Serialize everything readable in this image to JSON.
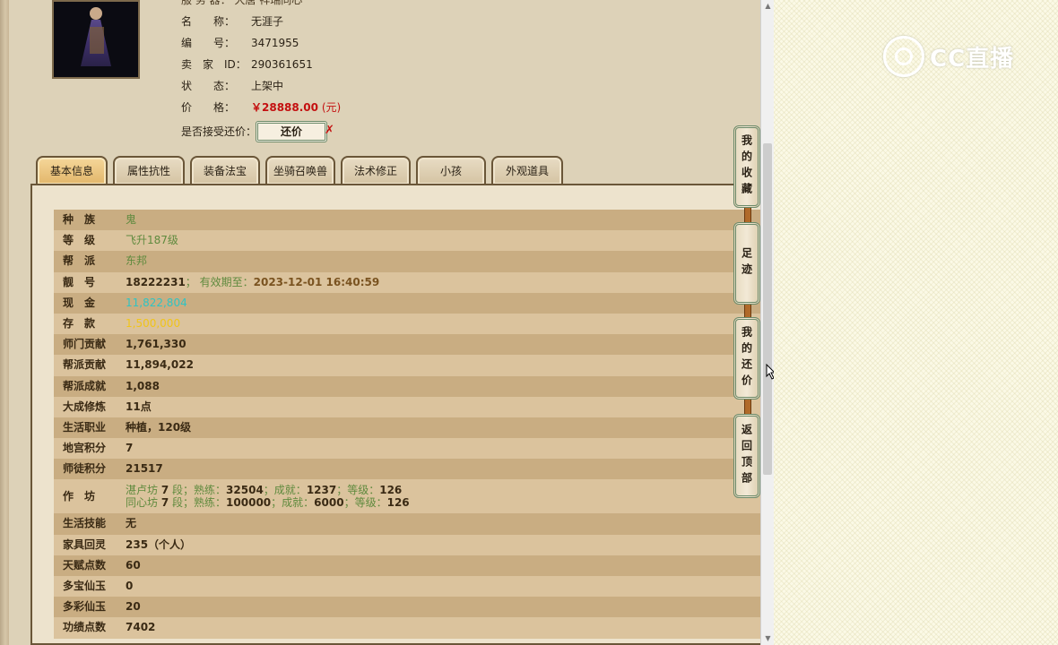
{
  "header": {
    "partial_row": "服 务 器：  大唐   祥瑞同心",
    "rows": [
      {
        "label": "名　　称：",
        "value": "无涯子"
      },
      {
        "label": "编　　号：",
        "value": "3471955"
      },
      {
        "label": "卖　家　ID：",
        "value": "290361651"
      },
      {
        "label": "状　　态：",
        "value": "上架中"
      }
    ],
    "price_label": "价　　格：",
    "price_value": "￥28888.00",
    "price_unit": "(元)",
    "counter_label": "是否接受还价：",
    "counter_button": "还价",
    "counter_x": "✗"
  },
  "tabs": [
    "基本信息",
    "属性抗性",
    "装备法宝",
    "坐骑召唤兽",
    "法术修正",
    "小孩",
    "外观道具"
  ],
  "active_tab": "基本信息",
  "details": [
    {
      "k": "种　族",
      "v": "鬼"
    },
    {
      "k": "等　级",
      "v": "飞升187级"
    },
    {
      "k": "帮　派",
      "v": "东邦"
    },
    {
      "k": "靓　号",
      "v1": "18222231",
      "v2": "；  有效期至：",
      "v3": "2023-12-01 16:40:59"
    },
    {
      "k": "现　金",
      "v": "11,822,804"
    },
    {
      "k": "存　款",
      "v": "1,500,000"
    },
    {
      "k": "师门贡献",
      "v": "1,761,330"
    },
    {
      "k": "帮派贡献",
      "v": "11,894,022"
    },
    {
      "k": "帮派成就",
      "v": "1,088"
    },
    {
      "k": "大成修炼",
      "v": "11点"
    },
    {
      "k": "生活职业",
      "v": "种植，120级"
    },
    {
      "k": "地宫积分",
      "v": "7"
    },
    {
      "k": "师徒积分",
      "v": "21517"
    },
    {
      "k": "作　坊",
      "line1": {
        "a": "湛卢坊",
        "b": "7",
        "c": "段；熟练：",
        "d": "32504",
        "e": "；成就：",
        "f": "1237",
        "g": "；等级：",
        "h": "126"
      },
      "line2": {
        "a": "同心坊",
        "b": "7",
        "c": "段；熟练：",
        "d": "100000",
        "e": "；成就：",
        "f": "6000",
        "g": "；等级：",
        "h": "126"
      }
    },
    {
      "k": "生活技能",
      "v": "无"
    },
    {
      "k": "家具回灵",
      "v": "235（个人）"
    },
    {
      "k": "天赋点数",
      "v": "60"
    },
    {
      "k": "多宝仙玉",
      "v": "0"
    },
    {
      "k": "多彩仙玉",
      "v": "20"
    },
    {
      "k": "功绩点数",
      "v": "7402"
    }
  ],
  "side_buttons": [
    "我的收藏",
    "足迹",
    "我的还价",
    "返回顶部"
  ],
  "watermark": "CC直播",
  "colors": {
    "accent_red": "#c41010",
    "value_green": "#5f8a3e",
    "cash_cyan": "#2fc4c4",
    "deposit_gold": "#f0c419"
  }
}
